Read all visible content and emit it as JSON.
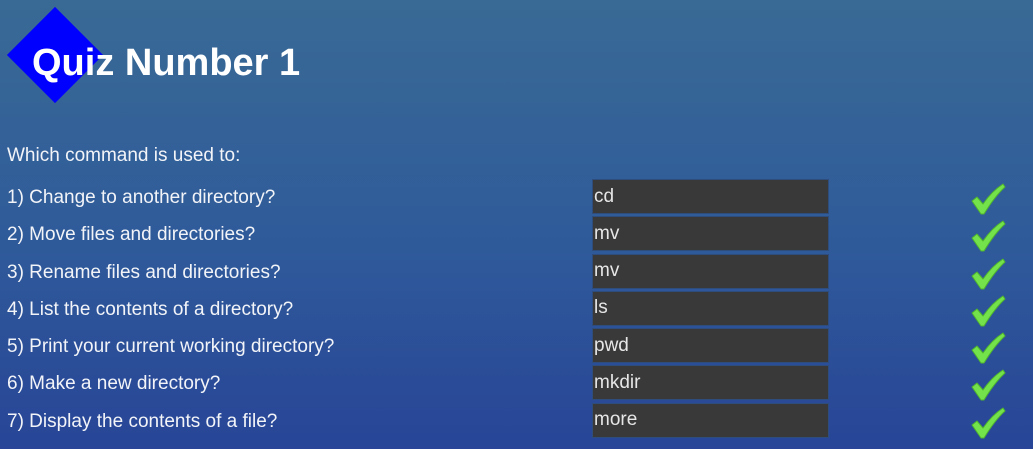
{
  "quiz": {
    "title": "Quiz Number 1",
    "prompt": "Which command is used to:",
    "questions": [
      {
        "label": "1) Change to another directory?",
        "answer": "cd",
        "status_icon": "check-icon"
      },
      {
        "label": "2) Move files and directories?",
        "answer": "mv",
        "status_icon": "check-icon"
      },
      {
        "label": "3) Rename files and directories?",
        "answer": "mv",
        "status_icon": "check-icon"
      },
      {
        "label": "4) List the contents of a directory?",
        "answer": "ls",
        "status_icon": "check-icon"
      },
      {
        "label": "5) Print your current working directory?",
        "answer": "pwd",
        "status_icon": "check-icon"
      },
      {
        "label": "6) Make a new directory?",
        "answer": "mkdir",
        "status_icon": "check-icon"
      },
      {
        "label": "7) Display the contents of a file?",
        "answer": "more",
        "status_icon": "check-icon"
      }
    ]
  },
  "colors": {
    "background_top": "#396a95",
    "background_bottom": "#284597",
    "diamond": "#0000ff",
    "answer_field": "#393939",
    "check": "#74e24a"
  }
}
